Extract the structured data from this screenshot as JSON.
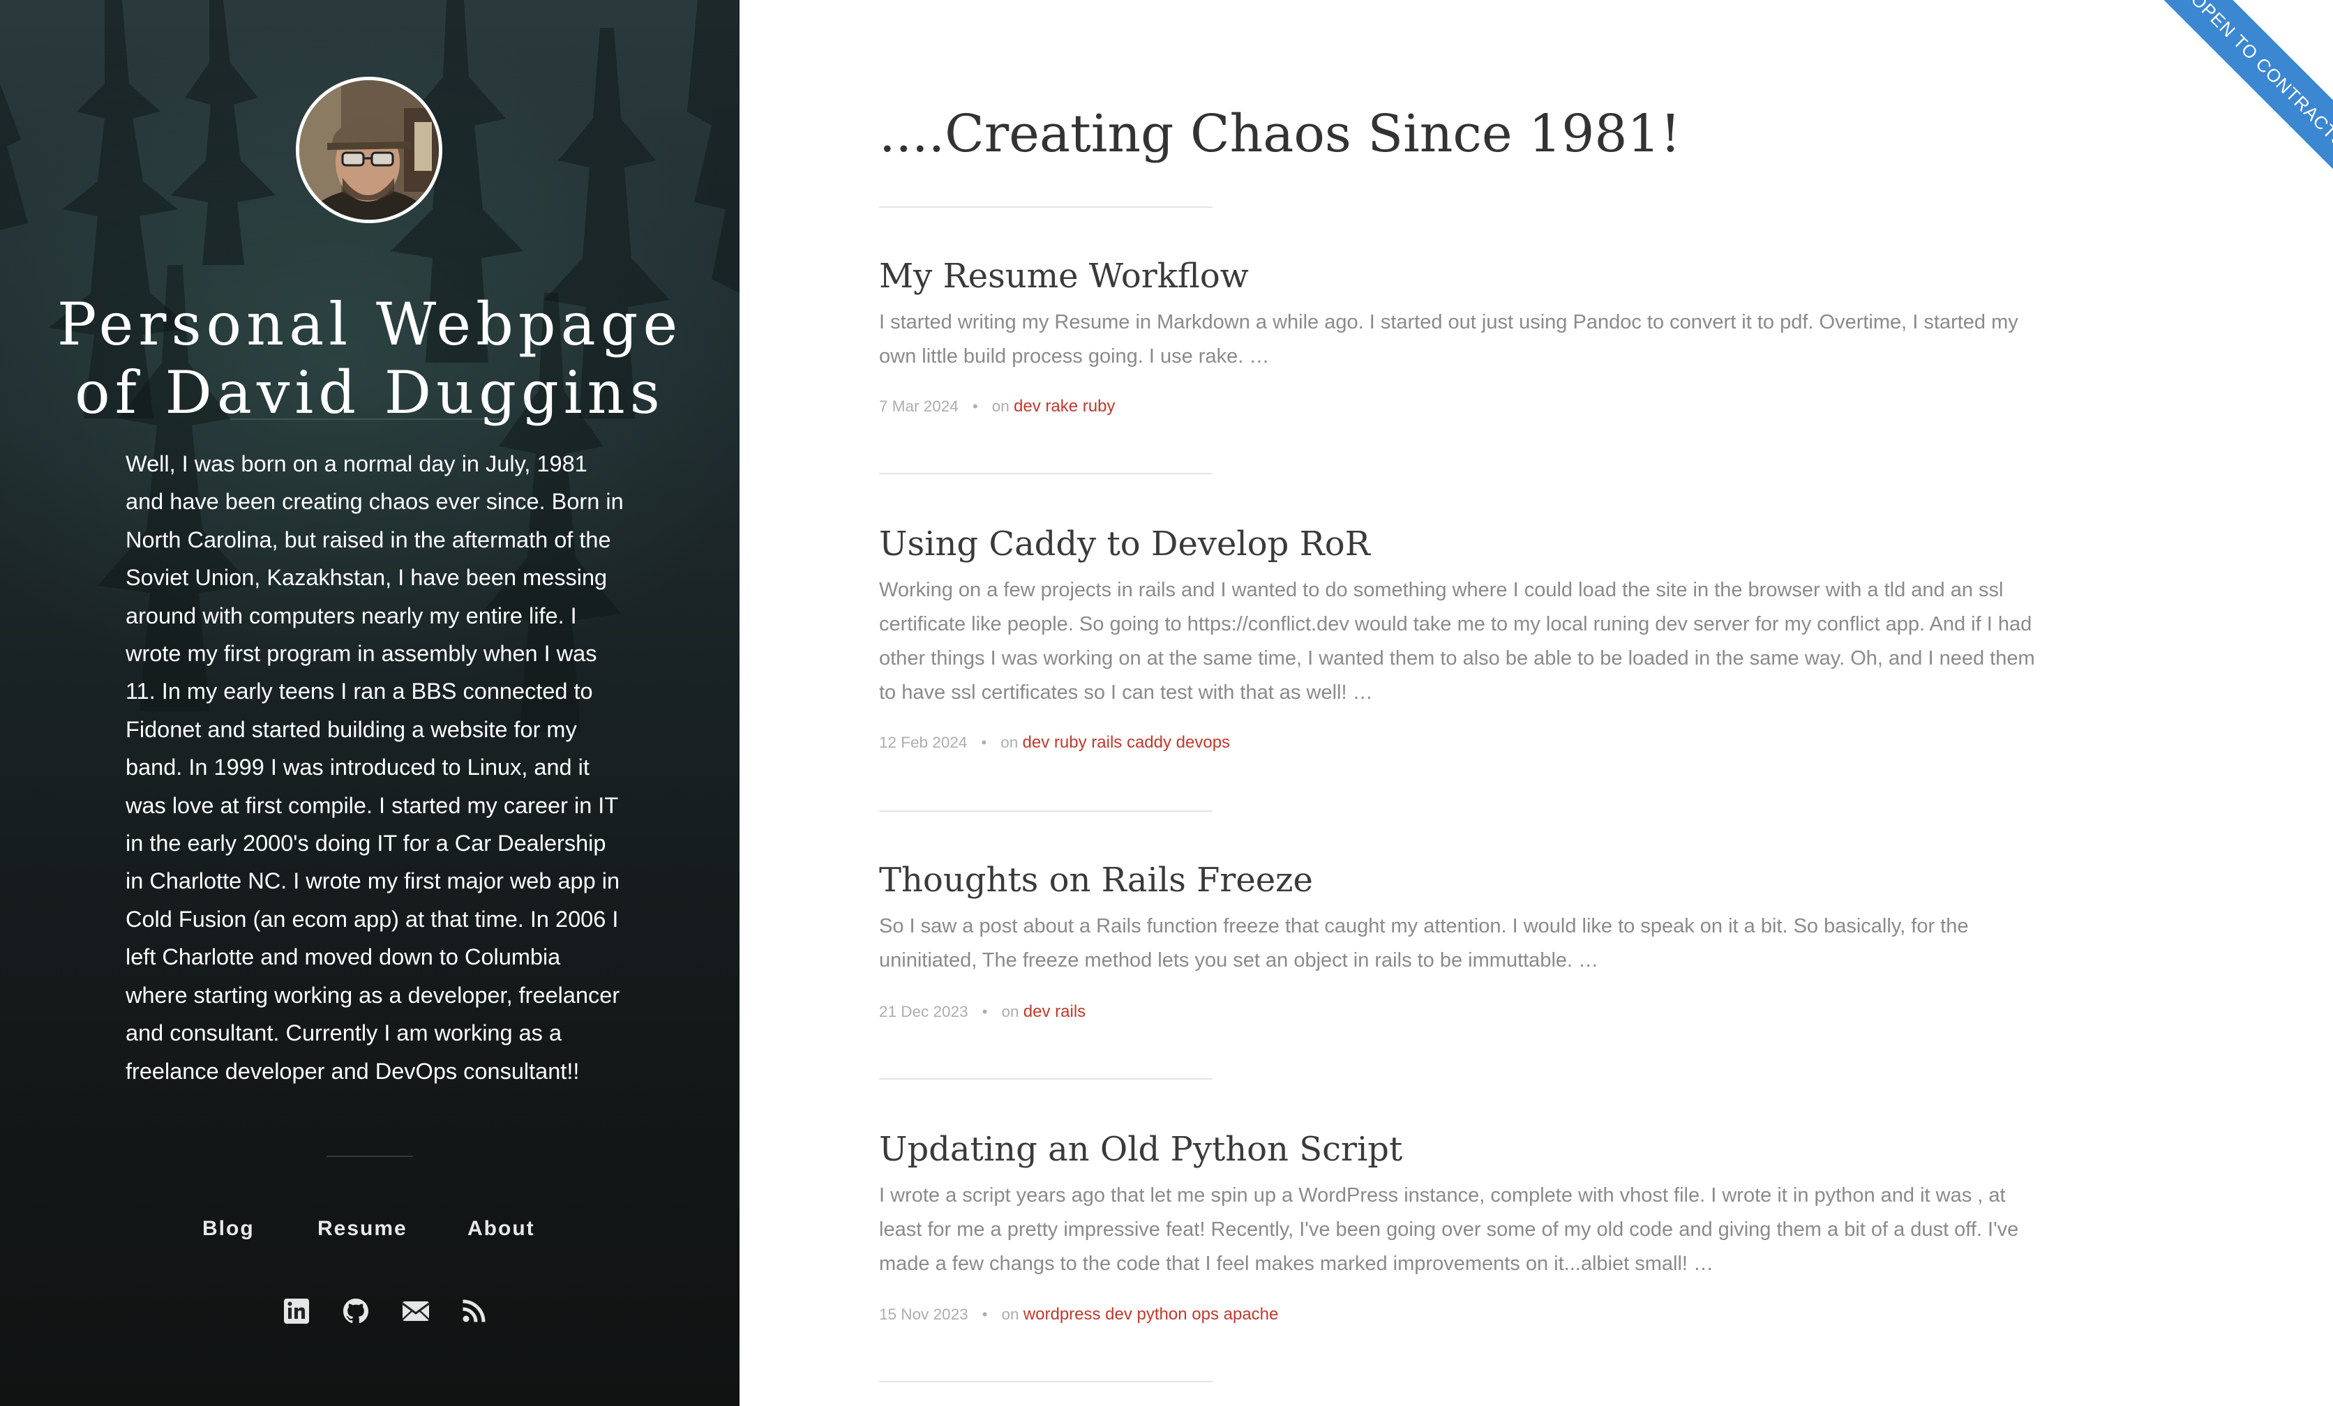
{
  "sidebar": {
    "title_line1": "Personal Webpage",
    "title_line2": "of David Duggins",
    "bio": "Well, I was born on a normal day in July, 1981 and have been creating chaos ever since. Born in North Carolina, but raised in the aftermath of the Soviet Union, Kazakhstan, I have been messing around with computers nearly my entire life. I wrote my first program in assembly when I was 11. In my early teens I ran a BBS connected to Fidonet and started building a website for my band. In 1999 I was introduced to Linux, and it was love at first compile. I started my career in IT in the early 2000's doing IT for a Car Dealership in Charlotte NC. I wrote my first major web app in Cold Fusion (an ecom app) at that time. In 2006 I left Charlotte and moved down to Columbia where starting working as a developer, freelancer and consultant. Currently I am working as a freelance developer and DevOps consultant!!",
    "nav": [
      {
        "label": "Blog"
      },
      {
        "label": "Resume"
      },
      {
        "label": "About"
      }
    ],
    "social_icons": [
      {
        "icon": "linkedin-icon"
      },
      {
        "icon": "github-icon"
      },
      {
        "icon": "email-icon"
      },
      {
        "icon": "rss-icon"
      }
    ]
  },
  "main": {
    "heading": "....Creating Chaos Since 1981!",
    "posts": [
      {
        "title": "My Resume Workflow",
        "excerpt": "I started writing my Resume in Markdown a while ago. I started out just using Pandoc to convert it to pdf. Overtime, I started my own little build process going. I use rake. …",
        "date": "7 Mar 2024",
        "on": "on",
        "tags": "dev rake ruby"
      },
      {
        "title": "Using Caddy to Develop RoR",
        "excerpt": "Working on a few projects in rails and I wanted to do something where I could load the site in the browser with a tld and an ssl certificate like people. So going to https://conflict.dev would take me to my local runing dev server for my conflict app. And if I had other things I was working on at the same time, I wanted them to also be able to be loaded in the same way. Oh, and I need them to have ssl certificates so I can test with that as well! …",
        "date": "12 Feb 2024",
        "on": "on",
        "tags": "dev ruby rails caddy devops"
      },
      {
        "title": "Thoughts on Rails Freeze",
        "excerpt": "So I saw a post about a Rails function freeze that caught my attention. I would like to speak on it a bit. So basically, for the uninitiated, The freeze method lets you set an object in rails to be immuttable. …",
        "date": "21 Dec 2023",
        "on": "on",
        "tags": "dev rails"
      },
      {
        "title": "Updating an Old Python Script",
        "excerpt": "I wrote a script years ago that let me spin up a WordPress instance, complete with vhost file. I wrote it in python and it was , at least for me a pretty impressive feat! Recently, I've been going over some of my old code and giving them a bit of a dust off. I've made a few changs to the code that I feel makes marked improvements on it...albiet small! …",
        "date": "15 Nov 2023",
        "on": "on",
        "tags": "wordpress dev python ops apache"
      }
    ],
    "meta_separator": "•"
  },
  "ribbon": {
    "label": "OPEN TO CONTRACTS",
    "color": "#3b87d1"
  },
  "colors": {
    "tag_link": "#c0392b",
    "sidebar_bg": "#1c2526",
    "heading": "#333333",
    "excerpt": "#8a8a8a"
  }
}
